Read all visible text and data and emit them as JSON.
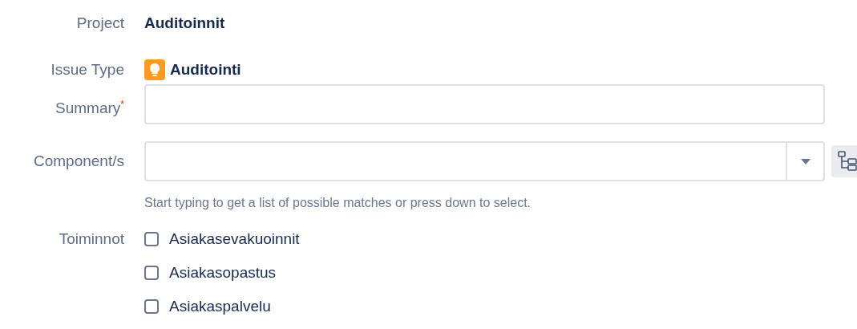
{
  "fields": [
    {
      "kind": "text",
      "label": "Project",
      "value": "Auditoinnit"
    },
    {
      "kind": "issue_type",
      "label": "Issue Type",
      "value": "Auditointi"
    },
    {
      "kind": "input",
      "label": "Summary$^{*}$"
    },
    {
      "kind": "select",
      "label": "Component/s",
      "hint": "Start typing to get a list of possible matches or press down to select."
    },
    {
      "kind": "checkboxes",
      "label": "Toiminnot",
      "options": [
        {
          "label": "Asiakasevakuoinnit",
          "checked": false
        },
        {
          "label": "Asiakasopastus",
          "checked": false
        },
        {
          "label": "Asiakaspalvelu",
          "checked": false
        }
      ]
    }
  ]
}
